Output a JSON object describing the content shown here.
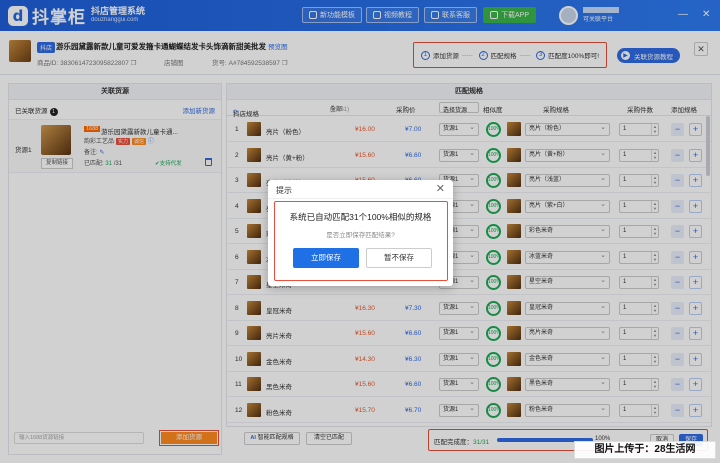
{
  "app": {
    "logo_mark": "d",
    "name": "抖掌柜",
    "slogan": "抖店管理系统",
    "site": "douzhanggui.com"
  },
  "topnav": {
    "buttons": [
      {
        "label": "新功能模板"
      },
      {
        "label": "视频教程"
      },
      {
        "label": "联系客服"
      },
      {
        "label": "下载APP"
      }
    ],
    "user_sub": "可关联平台",
    "min": "—",
    "close": "✕"
  },
  "product": {
    "tag": "抖店",
    "title": "游乐园黛露新款儿童可爱发箍卡通蝴蝶结发卡头饰滴新甜美批发",
    "link_label": "预览图",
    "id_label": "商品ID:",
    "id_value": "3830614723095822807",
    "goods_no_label": "货号:",
    "goods_no_value": "A#784592538597",
    "shop_label": "店铺图"
  },
  "steps": [
    {
      "num": "1",
      "label": "添加货源"
    },
    {
      "num": "2",
      "label": "匹配规格"
    },
    {
      "num": "3",
      "label": "匹配度100%即可!"
    }
  ],
  "tutorial_label": "关联货源教程",
  "left": {
    "title": "关联货源",
    "linked_label": "已关联货源",
    "linked_count": "1",
    "add_new": "添加新货源",
    "source_label": "货源1",
    "source_badge": "1688",
    "source_name": "游乐园黛露新款儿童卡通...",
    "shop": "韵彩工艺品",
    "badge1": "实力",
    "badge2": "诚信",
    "note_label": "备注:",
    "matched_label": "已匹配:",
    "matched_value": "31",
    "matched_total": "/31",
    "support_label": "支持代发",
    "copy_link": "复制链接",
    "search_placeholder": "输入1688货源链接",
    "add_button": "添加货源"
  },
  "right": {
    "title": "匹配规格",
    "col_spec": "抖店规格",
    "col_all": "全部",
    "col_count": "(31/31)",
    "col_cost": "采购价",
    "col_source_select": "选择货源",
    "col_similarity": "相似度",
    "col_purchase_spec": "采购规格",
    "col_qty": "采购件数",
    "col_add": "添加规格"
  },
  "rows": [
    {
      "idx": "1",
      "sku": "亮片（粉色）",
      "price": "¥16.00",
      "cost": "¥7.00",
      "source": "货源1",
      "sim": "100%",
      "spec": "亮片（粉色）",
      "qty": "1"
    },
    {
      "idx": "2",
      "sku": "亮片（黄+粉）",
      "price": "¥15.60",
      "cost": "¥6.60",
      "source": "货源1",
      "sim": "100%",
      "spec": "亮片（黄+粉）",
      "qty": "1"
    },
    {
      "idx": "3",
      "sku": "亮片（浅蓝）",
      "price": "¥15.60",
      "cost": "¥6.60",
      "source": "货源1",
      "sim": "100%",
      "spec": "亮片（浅蓝）",
      "qty": "1"
    },
    {
      "idx": "4",
      "sku": "亮片（紫+白）",
      "price": "¥15.60",
      "cost": "¥6.60",
      "source": "货源1",
      "sim": "100%",
      "spec": "亮片（紫+白）",
      "qty": "1"
    },
    {
      "idx": "5",
      "sku": "彩色米奇",
      "price": "¥14.30",
      "cost": "¥6.30",
      "source": "货源1",
      "sim": "100%",
      "spec": "彩色米奇",
      "qty": "1"
    },
    {
      "idx": "6",
      "sku": "冰蓝米奇",
      "price": "¥14.30",
      "cost": "¥6.30",
      "source": "货源1",
      "sim": "100%",
      "spec": "冰蓝米奇",
      "qty": "1"
    },
    {
      "idx": "7",
      "sku": "星空米奇",
      "price": "¥15.30",
      "cost": "¥6.30",
      "source": "货源1",
      "sim": "100%",
      "spec": "星空米奇",
      "qty": "1"
    },
    {
      "idx": "8",
      "sku": "皇冠米奇",
      "price": "¥16.30",
      "cost": "¥7.30",
      "source": "货源1",
      "sim": "100%",
      "spec": "皇冠米奇",
      "qty": "1"
    },
    {
      "idx": "9",
      "sku": "亮片米奇",
      "price": "¥15.60",
      "cost": "¥6.60",
      "source": "货源1",
      "sim": "100%",
      "spec": "亮片米奇",
      "qty": "1"
    },
    {
      "idx": "10",
      "sku": "金色米奇",
      "price": "¥14.30",
      "cost": "¥6.30",
      "source": "货源1",
      "sim": "100%",
      "spec": "金色米奇",
      "qty": "1"
    },
    {
      "idx": "11",
      "sku": "黑色米奇",
      "price": "¥15.60",
      "cost": "¥6.60",
      "source": "货源1",
      "sim": "100%",
      "spec": "黑色米奇",
      "qty": "1"
    },
    {
      "idx": "12",
      "sku": "粉色米奇",
      "price": "¥15.70",
      "cost": "¥6.70",
      "source": "货源1",
      "sim": "100%",
      "spec": "粉色米奇",
      "qty": "1"
    }
  ],
  "footer": {
    "ai_badge": "AI",
    "ai_match": "智能匹配规格",
    "clear_match": "清空已匹配",
    "progress_label": "匹配完成度：",
    "progress_value": "31/31",
    "progress_pct": "100%",
    "progress_fraction": 1.0,
    "cancel": "取消",
    "save": "保存"
  },
  "modal": {
    "title": "提示",
    "close": "✕",
    "message": "系统已自动匹配31个100%相似的规格",
    "question": "是否立即保存匹配结果?",
    "ok": "立即保存",
    "no": "暂不保存"
  },
  "watermark": "图片上传于：28生活网",
  "colors": {
    "brand": "#2f6be3",
    "highlight": "#e84f3c",
    "success": "#1aaa55",
    "price": "#e85a2a"
  }
}
